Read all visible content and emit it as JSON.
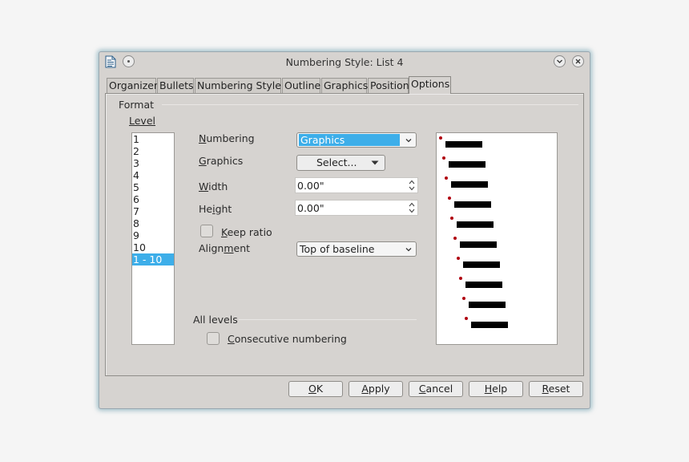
{
  "window": {
    "title": "Numbering Style: List 4"
  },
  "tabs": [
    "Organizer",
    "Bullets",
    "Numbering Style",
    "Outline",
    "Graphics",
    "Position",
    "Options"
  ],
  "active_tab": "Options",
  "format": {
    "section_label": "Format",
    "level_label": "Level",
    "levels": [
      "1",
      "2",
      "3",
      "4",
      "5",
      "6",
      "7",
      "8",
      "9",
      "10",
      "1 - 10"
    ],
    "selected_level": "1 - 10",
    "numbering": {
      "label_prefix": "N",
      "label_rest": "umbering",
      "value": "Graphics"
    },
    "graphics": {
      "label_prefix": "G",
      "label_rest": "raphics",
      "button": "Select..."
    },
    "width": {
      "label_prefix": "W",
      "label_rest": "idth",
      "value": "0.00\""
    },
    "height": {
      "label_start": "He",
      "label_u": "i",
      "label_rest": "ght",
      "value": "0.00\""
    },
    "keep_ratio": {
      "label_prefix": "K",
      "label_rest": "eep ratio",
      "checked": false
    },
    "alignment": {
      "label_start": "Align",
      "label_u": "m",
      "label_rest": "ent",
      "value": "Top of baseline"
    }
  },
  "all_levels": {
    "section_label": "All levels",
    "consecutive": {
      "label_prefix": "C",
      "label_rest": "onsecutive numbering",
      "checked": false
    }
  },
  "preview": {
    "bullet_color": "#b00010",
    "rows": 10
  },
  "buttons": {
    "ok": {
      "u": "O",
      "rest": "K"
    },
    "apply": {
      "u": "A",
      "rest": "pply"
    },
    "cancel": {
      "u": "C",
      "rest": "ancel"
    },
    "help": {
      "u": "H",
      "rest": "elp"
    },
    "reset": {
      "u": "R",
      "rest": "eset"
    }
  },
  "colors": {
    "selection": "#3daee9",
    "window_bg": "#d6d3d0",
    "glow": "#5f96a5"
  }
}
